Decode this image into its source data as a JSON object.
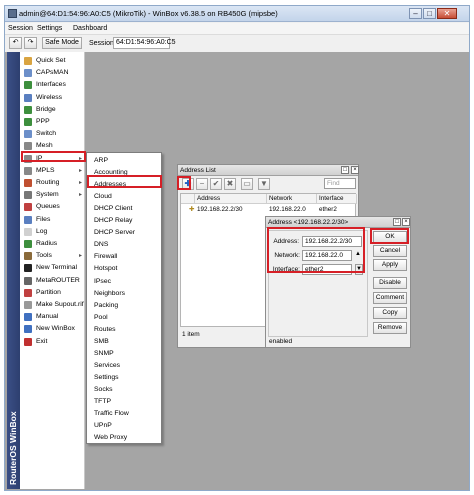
{
  "window": {
    "title": "admin@64:D1:54:96:A0:C5 (MikroTik) - WinBox v6.38.5 on RB450G (mipsbe)",
    "minimize_glyph": "–",
    "maximize_glyph": "□",
    "close_glyph": "✕"
  },
  "menubar": {
    "items": [
      "Session",
      "Settings",
      "Dashboard"
    ]
  },
  "toolbar": {
    "undo_glyph": "↶",
    "redo_glyph": "↷",
    "safe_mode_label": "Safe Mode",
    "session_label": "Session:",
    "session_value": "64:D1:54:96:A0:C5"
  },
  "sidebar": {
    "brand": "RouterOS WinBox",
    "items": [
      {
        "label": "Quick Set",
        "icon": "quickset-icon",
        "color": "#d9a441"
      },
      {
        "label": "CAPsMAN",
        "icon": "capsman-icon",
        "color": "#6c8fc9"
      },
      {
        "label": "Interfaces",
        "icon": "interfaces-icon",
        "color": "#3d8f3d"
      },
      {
        "label": "Wireless",
        "icon": "wireless-icon",
        "color": "#5a7fc0"
      },
      {
        "label": "Bridge",
        "icon": "bridge-icon",
        "color": "#3d8f3d"
      },
      {
        "label": "PPP",
        "icon": "ppp-icon",
        "color": "#3d8f3d"
      },
      {
        "label": "Switch",
        "icon": "switch-icon",
        "color": "#6c8fc9"
      },
      {
        "label": "Mesh",
        "icon": "mesh-icon",
        "color": "#888888"
      },
      {
        "label": "IP",
        "icon": "ip-icon",
        "color": "#888888",
        "submenu": true
      },
      {
        "label": "MPLS",
        "icon": "mpls-icon",
        "color": "#888888",
        "submenu": true
      },
      {
        "label": "Routing",
        "icon": "routing-icon",
        "color": "#c05030",
        "submenu": true
      },
      {
        "label": "System",
        "icon": "system-icon",
        "color": "#777777",
        "submenu": true
      },
      {
        "label": "Queues",
        "icon": "queues-icon",
        "color": "#c04040"
      },
      {
        "label": "Files",
        "icon": "files-icon",
        "color": "#5a7fc0"
      },
      {
        "label": "Log",
        "icon": "log-icon",
        "color": "#d0d0d0"
      },
      {
        "label": "Radius",
        "icon": "radius-icon",
        "color": "#3d8f3d"
      },
      {
        "label": "Tools",
        "icon": "tools-icon",
        "color": "#8a6a3a",
        "submenu": true
      },
      {
        "label": "New Terminal",
        "icon": "terminal-icon",
        "color": "#222222"
      },
      {
        "label": "MetaROUTER",
        "icon": "metarouter-icon",
        "color": "#666666"
      },
      {
        "label": "Partition",
        "icon": "partition-icon",
        "color": "#c04040"
      },
      {
        "label": "Make Supout.rif",
        "icon": "supout-icon",
        "color": "#999999"
      },
      {
        "label": "Manual",
        "icon": "manual-icon",
        "color": "#4070c0"
      },
      {
        "label": "New WinBox",
        "icon": "winbox-icon",
        "color": "#4070c0"
      },
      {
        "label": "Exit",
        "icon": "exit-icon",
        "color": "#c03030"
      }
    ]
  },
  "ip_submenu": {
    "items": [
      "ARP",
      "Accounting",
      "Addresses",
      "Cloud",
      "DHCP Client",
      "DHCP Relay",
      "DHCP Server",
      "DNS",
      "Firewall",
      "Hotspot",
      "IPsec",
      "Neighbors",
      "Packing",
      "Pool",
      "Routes",
      "SMB",
      "SNMP",
      "Services",
      "Settings",
      "Socks",
      "TFTP",
      "Traffic Flow",
      "UPnP",
      "Web Proxy"
    ]
  },
  "address_list": {
    "title": "Address List",
    "add_glyph": "✚",
    "remove_glyph": "−",
    "enable_glyph": "✔",
    "disable_glyph": "✖",
    "comment_glyph": "▭",
    "filter_glyph": "▼",
    "find_placeholder": "Find",
    "columns": [
      "Address",
      "Network",
      "Interface"
    ],
    "rows": [
      {
        "address": "192.168.22.2/30",
        "network": "192.168.22.0",
        "interface": "ether2"
      }
    ],
    "status": "1 item"
  },
  "address_dialog": {
    "title": "Address <192.168.22.2/30>",
    "address_label": "Address:",
    "address_value": "192.168.22.2/30",
    "network_label": "Network:",
    "network_value": "192.168.22.0",
    "interface_label": "Interface:",
    "interface_value": "ether2",
    "buttons": [
      "OK",
      "Cancel",
      "Apply",
      "Disable",
      "Comment",
      "Copy",
      "Remove"
    ],
    "status": "enabled"
  },
  "colors": {
    "highlight_red": "#d61f26",
    "brand_blue": "#2d3f6f",
    "add_blue": "#1f5fc4"
  }
}
